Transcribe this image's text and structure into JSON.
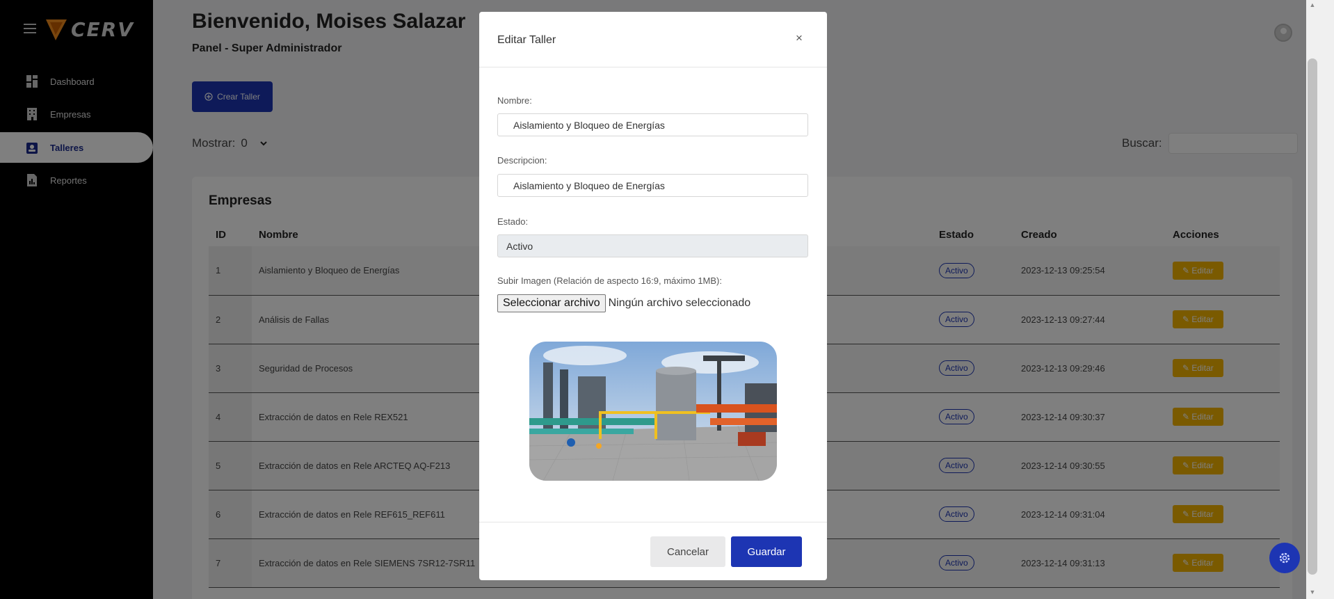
{
  "sidebar": {
    "logo_text": "CERV",
    "items": [
      {
        "label": "Dashboard",
        "icon": "dashboard-icon"
      },
      {
        "label": "Empresas",
        "icon": "building-icon"
      },
      {
        "label": "Talleres",
        "icon": "workshop-icon",
        "active": true
      },
      {
        "label": "Reportes",
        "icon": "report-icon"
      }
    ]
  },
  "header": {
    "welcome": "Bienvenido, Moises Salazar",
    "subtitle": "Panel - Super Administrador"
  },
  "toolbar": {
    "create_label": "Crear Taller",
    "show_label": "Mostrar:",
    "show_value": "0",
    "search_label": "Buscar:"
  },
  "table": {
    "title": "Empresas",
    "columns": [
      "ID",
      "Nombre",
      "Estado",
      "Creado",
      "Acciones"
    ],
    "rows": [
      {
        "id": "1",
        "name": "Aislamiento y Bloqueo de Energías",
        "status": "Activo",
        "created": "2023-12-13 09:25:54",
        "action": "Editar"
      },
      {
        "id": "2",
        "name": "Análisis de Fallas",
        "status": "Activo",
        "created": "2023-12-13 09:27:44",
        "action": "Editar"
      },
      {
        "id": "3",
        "name": "Seguridad de Procesos",
        "status": "Activo",
        "created": "2023-12-13 09:29:46",
        "action": "Editar"
      },
      {
        "id": "4",
        "name": "Extracción de datos en Rele REX521",
        "status": "Activo",
        "created": "2023-12-14 09:30:37",
        "action": "Editar"
      },
      {
        "id": "5",
        "name": "Extracción de datos en Rele ARCTEQ AQ-F213",
        "status": "Activo",
        "created": "2023-12-14 09:30:55",
        "action": "Editar"
      },
      {
        "id": "6",
        "name": "Extracción de datos en Rele REF615_REF611",
        "status": "Activo",
        "created": "2023-12-14 09:31:04",
        "action": "Editar"
      },
      {
        "id": "7",
        "name": "Extracción de datos en Rele SIEMENS 7SR12-7SR11",
        "status": "Activo",
        "created": "2023-12-14 09:31:13",
        "action": "Editar"
      }
    ]
  },
  "modal": {
    "title": "Editar Taller",
    "close": "×",
    "name_label": "Nombre:",
    "name_value": "Aislamiento y Bloqueo de Energías",
    "desc_label": "Descripcion:",
    "desc_value": "Aislamiento y Bloqueo de Energías",
    "state_label": "Estado:",
    "state_value": "Activo",
    "upload_label": "Subir Imagen (Relación de aspecto 16:9, máximo 1MB):",
    "file_button": "Seleccionar archivo",
    "file_status": "Ningún archivo seleccionado",
    "cancel": "Cancelar",
    "save": "Guardar"
  },
  "colors": {
    "primary": "#1d35b3",
    "warning": "#f5b400",
    "sidebar_bg": "#000000"
  }
}
